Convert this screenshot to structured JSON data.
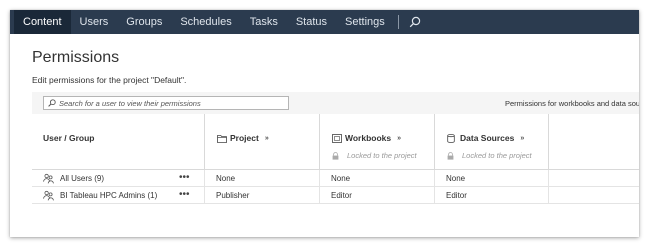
{
  "nav": {
    "items": [
      {
        "label": "Content",
        "active": true
      },
      {
        "label": "Users",
        "active": false
      },
      {
        "label": "Groups",
        "active": false
      },
      {
        "label": "Schedules",
        "active": false
      },
      {
        "label": "Tasks",
        "active": false
      },
      {
        "label": "Status",
        "active": false
      },
      {
        "label": "Settings",
        "active": false
      }
    ],
    "search_icon": "search-icon"
  },
  "page": {
    "title": "Permissions",
    "subtitle": "Edit permissions for the project \"Default\"."
  },
  "toolbar": {
    "search_placeholder": "Search for a user to view their permissions",
    "permissions_for": "Permissions for workbooks and data sou"
  },
  "table": {
    "user_header": "User / Group",
    "columns": [
      {
        "label": "Project",
        "icon": "folder-icon",
        "locked_text": ""
      },
      {
        "label": "Workbooks",
        "icon": "workbook-icon",
        "locked_text": "Locked to the project"
      },
      {
        "label": "Data Sources",
        "icon": "database-icon",
        "locked_text": "Locked to the project"
      }
    ],
    "rows": [
      {
        "name": "All Users (9)",
        "project": "None",
        "workbooks": "None",
        "data_sources": "None"
      },
      {
        "name": "BI Tableau HPC Admins (1)",
        "project": "Publisher",
        "workbooks": "Editor",
        "data_sources": "Editor"
      }
    ],
    "more_label": "•••",
    "expand_label": "»"
  },
  "colors": {
    "navbar": "#2b3b4f",
    "navbar_active": "#1a2838",
    "toolbar_bg": "#f5f5f5"
  }
}
